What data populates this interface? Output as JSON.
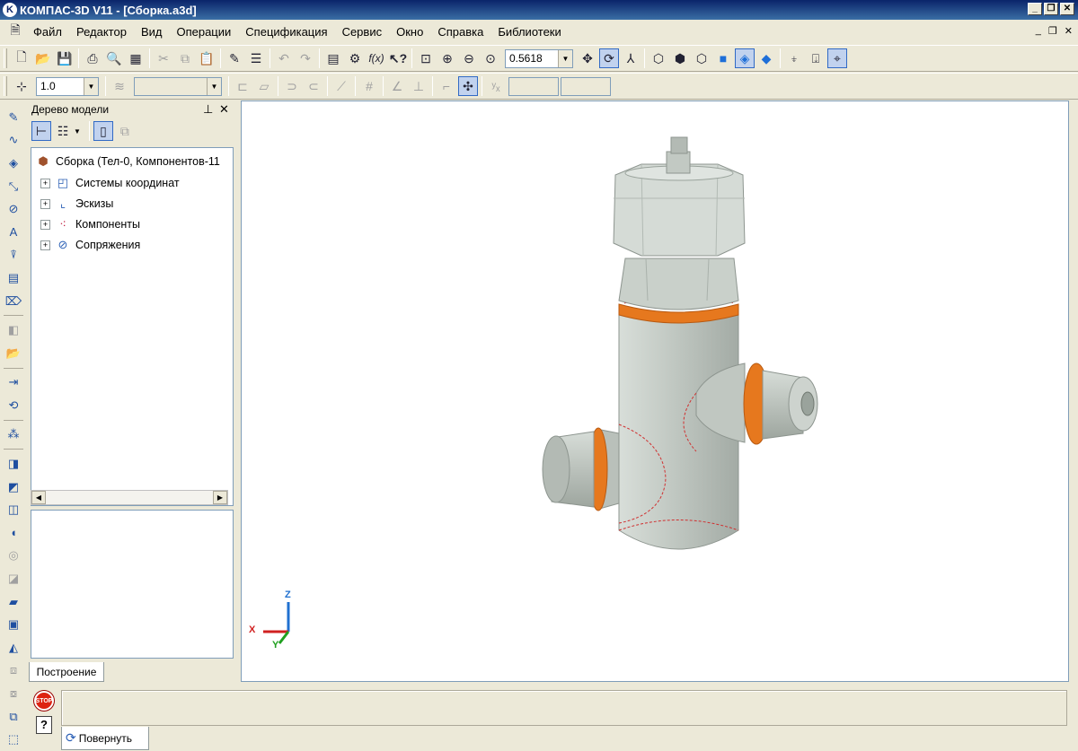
{
  "window": {
    "title": "КОМПАС-3D V11 - [Сборка.a3d]",
    "app_icon": "kompas-logo-icon",
    "controls": [
      "_",
      "❐",
      "✕"
    ],
    "mdi_controls": [
      "_",
      "❐",
      "✕"
    ]
  },
  "menu": [
    "Файл",
    "Редактор",
    "Вид",
    "Операции",
    "Спецификация",
    "Сервис",
    "Окно",
    "Справка",
    "Библиотеки"
  ],
  "toolbar1": {
    "zoom_value": "0.5618"
  },
  "toolbar2": {
    "scale_value": "1.0",
    "layer_value": ""
  },
  "tree": {
    "header": "Дерево модели",
    "pin_icon": "pin-icon",
    "close_icon": "close-icon",
    "items": [
      {
        "label": "Сборка (Тел-0, Компонентов-11",
        "icon": "assembly-icon",
        "expander": ""
      },
      {
        "label": "Системы координат",
        "icon": "coordinate-systems-icon",
        "expander": "+"
      },
      {
        "label": "Эскизы",
        "icon": "sketches-icon",
        "expander": "+"
      },
      {
        "label": "Компоненты",
        "icon": "components-icon",
        "expander": "+"
      },
      {
        "label": "Сопряжения",
        "icon": "mates-icon",
        "expander": "+"
      }
    ],
    "tab": "Построение"
  },
  "viewport": {
    "axis_x": "X",
    "axis_y": "Y",
    "axis_z": "Z",
    "colors": {
      "body": "#c8cfc9",
      "shade": "#9aa39c",
      "ring": "#e6781e",
      "edge": "#d03030"
    }
  },
  "bottom": {
    "stop_label": "STOP",
    "help_label": "?",
    "rotate_tab": "Повернуть"
  }
}
